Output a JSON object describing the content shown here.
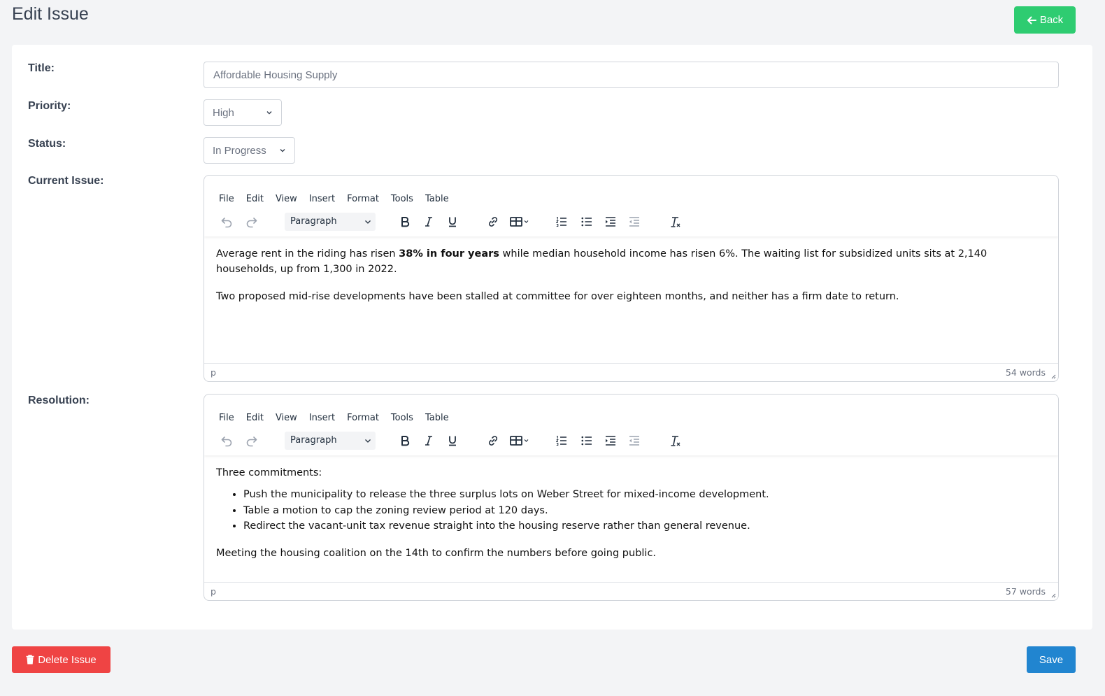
{
  "page": {
    "title": "Edit Issue",
    "back_label": "Back"
  },
  "form": {
    "title_label": "Title:",
    "title_value": "Affordable Housing Supply",
    "priority_label": "Priority:",
    "priority_value": "High",
    "status_label": "Status:",
    "status_value": "In Progress",
    "current_issue_label": "Current Issue:",
    "resolution_label": "Resolution:"
  },
  "editor_menu": [
    "File",
    "Edit",
    "View",
    "Insert",
    "Format",
    "Tools",
    "Table"
  ],
  "editor_block_format": "Paragraph",
  "current_issue": {
    "p1_before": "Average rent in the riding has risen ",
    "p1_bold": "38% in four years",
    "p1_after": " while median household income has risen 6%. The waiting list for subsidized units sits at 2,140 households, up from 1,300 in 2022.",
    "p2": "Two proposed mid-rise developments have been stalled at committee for over eighteen months, and neither has a firm date to return.",
    "path": "p",
    "word_count": "54 words"
  },
  "resolution": {
    "intro": "Three commitments:",
    "items": [
      "Push the municipality to release the three surplus lots on Weber Street for mixed-income development.",
      "Table a motion to cap the zoning review period at 120 days.",
      "Redirect the vacant-unit tax revenue straight into the housing reserve rather than general revenue."
    ],
    "outro": "Meeting the housing coalition on the 14th to confirm the numbers before going public.",
    "path": "p",
    "word_count": "57 words"
  },
  "actions": {
    "delete_label": "Delete Issue",
    "save_label": "Save"
  },
  "colors": {
    "back": "#2ecc71",
    "delete": "#ef4444",
    "save": "#2185d0"
  }
}
